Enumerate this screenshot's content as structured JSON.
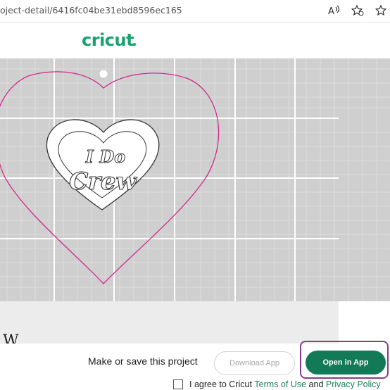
{
  "browser": {
    "url": "oject-detail/6416fc04be31ebd8596ec165",
    "icons": [
      "read-aloud-icon",
      "favorite-star-icon",
      "add-favorite-icon"
    ]
  },
  "header": {
    "logo_text": "cricut",
    "logo_color": "#17a370"
  },
  "preview": {
    "design_text_line1": "I Do",
    "design_text_line2": "Crew",
    "outline_color": "#d02b8a",
    "grid_background": "#cfcfcf"
  },
  "page": {
    "peek_title": "W"
  },
  "actions": {
    "prompt": "Make or save this project",
    "download_label": "Download App",
    "open_label": "Open in App",
    "open_color": "#127a57",
    "highlight_color": "#8b3a8f",
    "agree_prefix": "I agree to Cricut",
    "terms_link": "Terms of Use",
    "and_text": "and",
    "privacy_link": "Privacy Policy"
  }
}
